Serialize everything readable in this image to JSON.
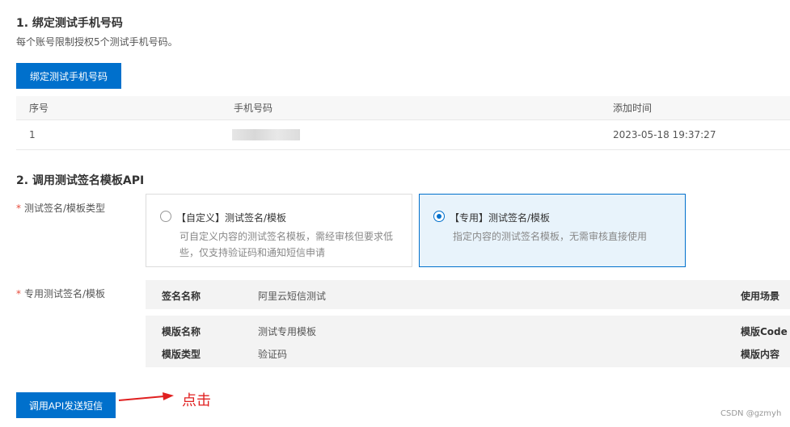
{
  "section1": {
    "title": "1. 绑定测试手机号码",
    "description": "每个账号限制授权5个测试手机号码。",
    "bind_button": "绑定测试手机号码",
    "table": {
      "headers": [
        "序号",
        "手机号码",
        "添加时间"
      ],
      "rows": [
        {
          "index": "1",
          "phone": "",
          "added_time": "2023-05-18 19:37:27"
        }
      ]
    }
  },
  "section2": {
    "title": "2. 调用测试签名模板API",
    "type_label": "测试签名/模板类型",
    "template_label": "专用测试签名/模板",
    "options": [
      {
        "title": "【自定义】测试签名/模板",
        "description_line1": "可自定义内容的测试签名模板，需经审核但要求低",
        "description_line2": "些，仅支持验证码和通知短信申请",
        "selected": false
      },
      {
        "title": "【专用】测试签名/模板",
        "description_line1": "指定内容的测试签名模板，无需审核直接使用",
        "description_line2": "",
        "selected": true
      }
    ],
    "signature": {
      "key": "签名名称",
      "value": "阿里云短信测试",
      "right_key": "使用场景"
    },
    "template": {
      "name_key": "模版名称",
      "name_value": "测试专用模板",
      "name_right_key": "模版Code",
      "type_key": "模版类型",
      "type_value": "验证码",
      "type_right_key": "模版内容"
    },
    "call_button": "调用API发送短信"
  },
  "annotation": {
    "text": "点击",
    "color": "#e02020"
  },
  "watermark": "CSDN @gzmyh",
  "colors": {
    "primary": "#0070cc",
    "selected_bg": "#e8f3fb",
    "required": "#e74c3c"
  }
}
